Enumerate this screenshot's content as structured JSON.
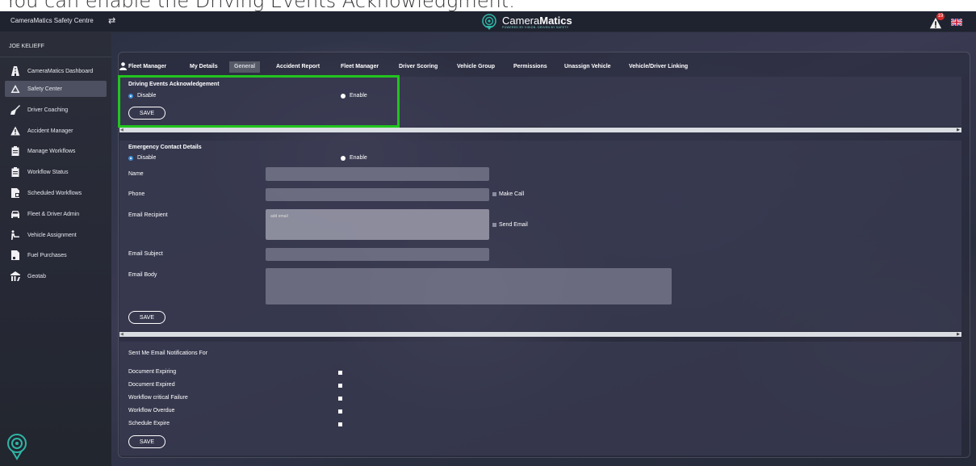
{
  "caption": "You can enable the Driving Events Acknowledgment.",
  "topbar": {
    "app_title": "CameraMatics Safety Centre",
    "brand_prefix": "Camera",
    "brand_bold": "Matics",
    "brand_tagline": "POWERED BY VISION. DRIVEN BY SAFETY",
    "alert_count": "19"
  },
  "sidebar": {
    "user_name": "JOE KELIEFF",
    "items": [
      {
        "label": "CameraMatics Dashboard",
        "icon": "road-icon"
      },
      {
        "label": "Safety Center",
        "icon": "warning-outline-icon"
      },
      {
        "label": "Driver Coaching",
        "icon": "broom-icon"
      },
      {
        "label": "Accident Manager",
        "icon": "warning-icon"
      },
      {
        "label": "Manage Workflows",
        "icon": "clipboard-icon"
      },
      {
        "label": "Workflow Status",
        "icon": "clipboard-icon"
      },
      {
        "label": "Scheduled Workflows",
        "icon": "file-icon"
      },
      {
        "label": "Fleet & Driver Admin",
        "icon": "car-icon"
      },
      {
        "label": "Vehicle Assignment",
        "icon": "person-car-icon"
      },
      {
        "label": "Fuel Purchases",
        "icon": "receipt-icon"
      },
      {
        "label": "Geotab",
        "icon": "chart-icon"
      }
    ],
    "active_index": 1
  },
  "tabs": {
    "title": "Fleet Manager",
    "items": [
      "My Details",
      "General",
      "Accident Report",
      "Fleet Manager",
      "Driver Scoring",
      "Vehicle Group",
      "Permissions",
      "Unassign Vehicle",
      "Vehicle/Driver Linking"
    ],
    "active": "General"
  },
  "dea": {
    "title": "Driving Events Acknowledgement",
    "disable_label": "Disable",
    "enable_label": "Enable",
    "selected": "Disable",
    "save_label": "SAVE"
  },
  "ecd": {
    "title": "Emergency Contact Details",
    "disable_label": "Disable",
    "enable_label": "Enable",
    "selected": "Disable",
    "name_label": "Name",
    "name_value": "",
    "phone_label": "Phone",
    "phone_value": "",
    "make_call_label": "Make Call",
    "email_recipient_label": "Email Recipient",
    "email_recipient_placeholder": "add email",
    "send_email_label": "Send Email",
    "email_subject_label": "Email Subject",
    "email_subject_value": "",
    "email_body_label": "Email Body",
    "email_body_value": "",
    "save_label": "SAVE"
  },
  "notif": {
    "title": "Sent Me Email Notifications For",
    "items": [
      "Document Expiring",
      "Document Expired",
      "Workflow critical Failure",
      "Workflow Overdue",
      "Schedule Expire"
    ],
    "save_label": "SAVE"
  },
  "colors": {
    "highlight": "#22c41e",
    "accent_teal": "#2fb6a6",
    "radio_selected": "#3d8fd8",
    "alert_red": "#d42b2b"
  }
}
